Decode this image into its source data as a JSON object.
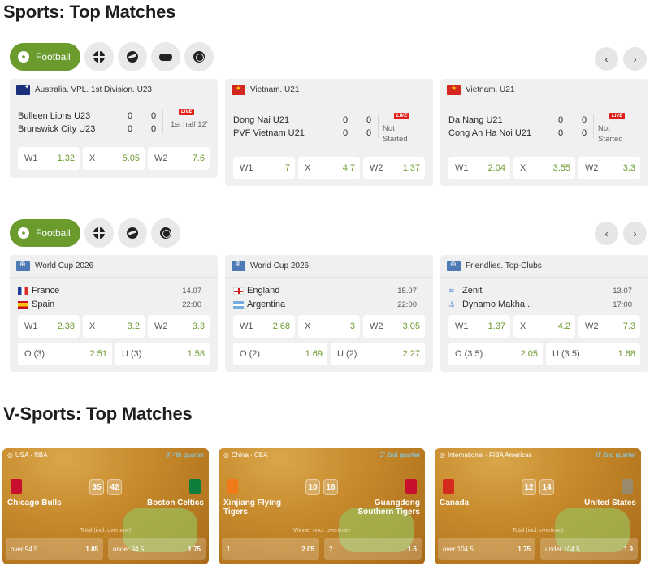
{
  "sports_section": {
    "title": "Sports: Top Matches"
  },
  "tabs1": {
    "active_label": "Football",
    "icons": [
      "basketball-icon",
      "tennis-icon",
      "esports-icon",
      "volleyball-icon"
    ]
  },
  "tabs2": {
    "active_label": "Football",
    "icons": [
      "basketball-icon",
      "tennis-icon",
      "volleyball-icon"
    ]
  },
  "nav": {
    "prev": "‹",
    "next": "›"
  },
  "live_cards": [
    {
      "league": "Australia. VPL. 1st Division. U23",
      "flag": "au",
      "team1": "Bulleen Lions U23",
      "team2": "Brunswick City U23",
      "score1": [
        "0",
        "0"
      ],
      "score2": [
        "0",
        "0"
      ],
      "live": "LIVE",
      "status": "1st half 12'",
      "odds": [
        {
          "label": "W1",
          "value": "1.32"
        },
        {
          "label": "X",
          "value": "5.05"
        },
        {
          "label": "W2",
          "value": "7.6"
        }
      ]
    },
    {
      "league": "Vietnam. U21",
      "flag": "vn",
      "team1": "Dong Nai U21",
      "team2": "PVF Vietnam U21",
      "score1": [
        "0",
        "0"
      ],
      "score2": [
        "0",
        "0"
      ],
      "live": "LIVE",
      "status": "Not\nStarted",
      "odds": [
        {
          "label": "W1",
          "value": "7"
        },
        {
          "label": "X",
          "value": "4.7"
        },
        {
          "label": "W2",
          "value": "1.37"
        }
      ]
    },
    {
      "league": "Vietnam. U21",
      "flag": "vn",
      "team1": "Da Nang U21",
      "team2": "Cong An Ha Noi U21",
      "score1": [
        "0",
        "0"
      ],
      "score2": [
        "0",
        "0"
      ],
      "live": "LIVE",
      "status": "Not\nStarted",
      "odds": [
        {
          "label": "W1",
          "value": "2.04"
        },
        {
          "label": "X",
          "value": "3.55"
        },
        {
          "label": "W2",
          "value": "3.3"
        }
      ]
    }
  ],
  "upcoming_cards": [
    {
      "league": "World Cup 2026",
      "team1": "France",
      "team2": "Spain",
      "date": "14.07",
      "time": "22:00",
      "odds": [
        {
          "label": "W1",
          "value": "2.38"
        },
        {
          "label": "X",
          "value": "3.2"
        },
        {
          "label": "W2",
          "value": "3.3"
        }
      ],
      "totals": [
        {
          "label": "O (3)",
          "value": "2.51"
        },
        {
          "label": "U (3)",
          "value": "1.58"
        }
      ]
    },
    {
      "league": "World Cup 2026",
      "team1": "England",
      "team2": "Argentina",
      "date": "15.07",
      "time": "22:00",
      "odds": [
        {
          "label": "W1",
          "value": "2.68"
        },
        {
          "label": "X",
          "value": "3"
        },
        {
          "label": "W2",
          "value": "3.05"
        }
      ],
      "totals": [
        {
          "label": "O (2)",
          "value": "1.69"
        },
        {
          "label": "U (2)",
          "value": "2.27"
        }
      ]
    },
    {
      "league": "Friendlies. Top-Clubs",
      "team1": "Zenit",
      "team2": "Dynamo Makha...",
      "date": "13.07",
      "time": "17:00",
      "odds": [
        {
          "label": "W1",
          "value": "1.37"
        },
        {
          "label": "X",
          "value": "4.2"
        },
        {
          "label": "W2",
          "value": "7.3"
        }
      ],
      "totals": [
        {
          "label": "O (3.5)",
          "value": "2.05"
        },
        {
          "label": "U (3.5)",
          "value": "1.68"
        }
      ]
    }
  ],
  "vsports_section": {
    "title": "V-Sports: Top Matches"
  },
  "vcards": [
    {
      "league": "USA · NBA",
      "phase": "3' 4th quarter",
      "team1": "Chicago Bulls",
      "team2": "Boston Celtics",
      "score1": "35",
      "score2": "42",
      "market": "Total (incl. overtime)",
      "odds": [
        {
          "label": "over 94.5",
          "value": "1.85"
        },
        {
          "label": "under 94.5",
          "value": "1.75"
        }
      ],
      "colors": [
        "#c8102e",
        "#0e7c3a"
      ]
    },
    {
      "league": "China · CBA",
      "phase": "2' 2nd quarter",
      "team1": "Xinjiang Flying Tigers",
      "team2": "Guangdong Southern Tigers",
      "score1": "10",
      "score2": "16",
      "market": "Winner (incl. overtime)",
      "odds": [
        {
          "label": "1",
          "value": "2.05"
        },
        {
          "label": "2",
          "value": "1.6"
        }
      ],
      "colors": [
        "#f07a1a",
        "#c8102e"
      ]
    },
    {
      "league": "International · FIBA Americas",
      "phase": "0' 2nd quarter",
      "team1": "Canada",
      "team2": "United States",
      "score1": "12",
      "score2": "14",
      "market": "Total (incl. overtime)",
      "odds": [
        {
          "label": "over 104.5",
          "value": "1.75"
        },
        {
          "label": "under 104.5",
          "value": "1.9"
        }
      ],
      "colors": [
        "#d52b1e",
        "#9a8a6c"
      ]
    }
  ]
}
